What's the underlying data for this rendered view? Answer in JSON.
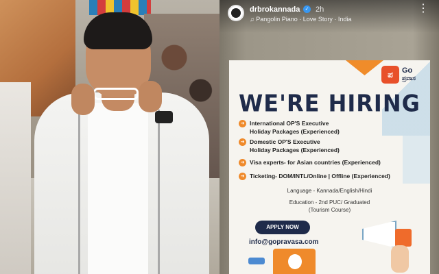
{
  "story": {
    "username": "drbrokannada",
    "time_ago": "2h",
    "song": "♫ Pangolin Piano · Love Story · India"
  },
  "poster": {
    "logo": {
      "mark": "ಪ",
      "brand": "Go",
      "brand_sub": "ಪ್ರವಾಸ"
    },
    "title": "WE'RE HIRING",
    "jobs": [
      {
        "line1": "International OP'S Executive",
        "line2": "Holiday Packages (Experienced)"
      },
      {
        "line1": "Domestic OP'S Executive",
        "line2": "Holiday Packages (Experienced)"
      },
      {
        "line1": "Visa experts- for Asian countries (Experienced)",
        "line2": ""
      },
      {
        "line1": "Ticketing- DOM/INTL/Online | Offline (Experienced)",
        "line2": ""
      }
    ],
    "language": "Language - Kannada/English/Hindi",
    "education_line1": "Education - 2nd PUC/ Graduated",
    "education_line2": "(Tourism Course)",
    "apply_label": "APPLY NOW",
    "email": "info@gopravasa.com"
  },
  "icons": {
    "more": "more-vertical-icon",
    "verified": "verified-badge-icon",
    "bullet": "arrow-right-icon"
  },
  "colors": {
    "navy": "#1f2b4a",
    "orange": "#ef8a2b",
    "verified_blue": "#3897f0"
  }
}
